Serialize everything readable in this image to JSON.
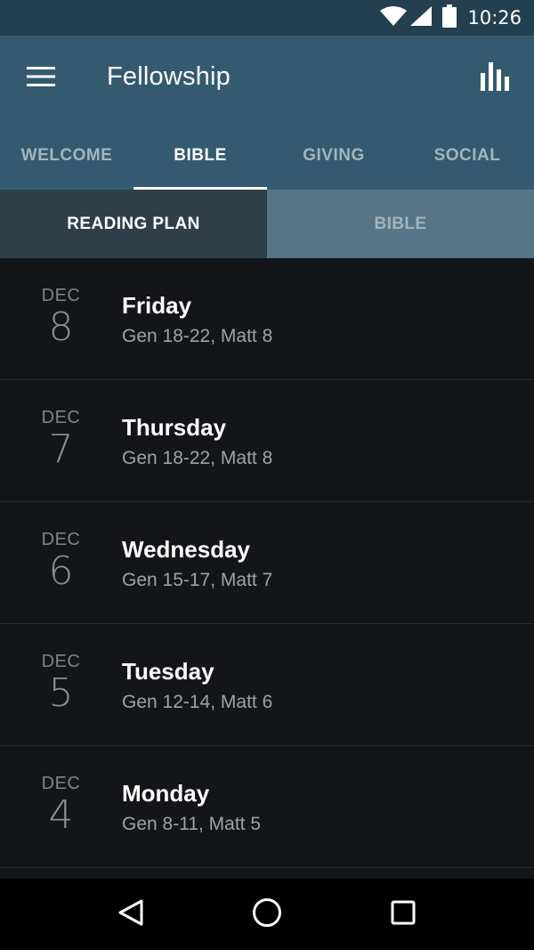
{
  "status_bar": {
    "time": "10:26",
    "icons": [
      "wifi-icon",
      "cell-signal-icon",
      "battery-icon"
    ]
  },
  "app_bar": {
    "title": "Fellowship",
    "menu_icon": "hamburger-menu-icon",
    "action_icon": "bar-chart-icon"
  },
  "tabs": [
    {
      "label": "WELCOME",
      "active": false
    },
    {
      "label": "BIBLE",
      "active": true
    },
    {
      "label": "GIVING",
      "active": false
    },
    {
      "label": "SOCIAL",
      "active": false
    }
  ],
  "subtabs": [
    {
      "label": "READING PLAN",
      "active": true
    },
    {
      "label": "BIBLE",
      "active": false
    }
  ],
  "reading_plan": [
    {
      "month": "DEC",
      "day": "8",
      "weekday": "Friday",
      "passages": "Gen 18-22, Matt 8"
    },
    {
      "month": "DEC",
      "day": "7",
      "weekday": "Thursday",
      "passages": "Gen 18-22, Matt 8"
    },
    {
      "month": "DEC",
      "day": "6",
      "weekday": "Wednesday",
      "passages": "Gen 15-17, Matt 7"
    },
    {
      "month": "DEC",
      "day": "5",
      "weekday": "Tuesday",
      "passages": "Gen 12-14, Matt 6"
    },
    {
      "month": "DEC",
      "day": "4",
      "weekday": "Monday",
      "passages": "Gen 8-11, Matt 5"
    }
  ],
  "nav_bar": {
    "icons": [
      "back-icon",
      "home-icon",
      "recents-icon"
    ]
  },
  "colors": {
    "app_bar": "#345a70",
    "status_bar": "#244050",
    "subtab_active": "#2e3f4a",
    "subtab_inactive": "#577586",
    "list_background": "#131518"
  }
}
